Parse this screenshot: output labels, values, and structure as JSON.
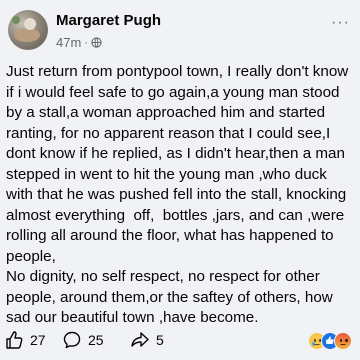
{
  "post": {
    "author": "Margaret Pugh",
    "time": "47m",
    "separator": "·",
    "more": "···",
    "text": "Just return from pontypool town, I really don't know if i would feel safe to go again,a young man stood by a stall,a woman approached him and started ranting, for no apparent reason that I could see,I dont know if he replied, as I didn't hear,then a man stepped in went to hit the young man ,who duck with that he was pushed fell into the stall, knocking  almost everything  off,  bottles ,jars, and can ,were rolling all around the floor, what has happened to people,\nNo dignity, no self respect, no respect for other people, around them,or the saftey of others, how sad our beautiful town ,have become."
  },
  "footer": {
    "likes": "27",
    "comments": "25",
    "shares": "5"
  },
  "icons": {
    "privacy": "globe-icon",
    "like": "thumbs-up-icon",
    "comment": "comment-bubble-icon",
    "share": "share-arrow-icon",
    "reactions": [
      "sad-reaction-icon",
      "like-reaction-icon",
      "angry-reaction-icon"
    ]
  },
  "colors": {
    "background": "#f0f2f5",
    "text": "#050505",
    "secondary": "#65676b",
    "like_blue": "#1b74e4"
  }
}
